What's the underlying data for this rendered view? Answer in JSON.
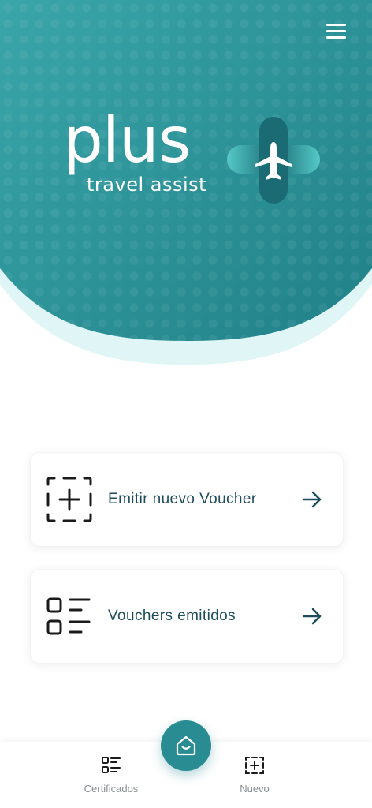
{
  "header": {
    "logo_word": "plus",
    "logo_tagline": "travel assist",
    "colors": {
      "teal_dark": "#1f7f86",
      "teal_light": "#3aa6a9",
      "ring": "#dff5f6"
    },
    "menu_icon": "hamburger-menu-icon"
  },
  "actions": [
    {
      "label": "Emitir nuevo Voucher",
      "icon": "add-square-icon",
      "arrow_icon": "arrow-right-icon"
    },
    {
      "label": "Vouchers emitidos",
      "icon": "list-icon",
      "arrow_icon": "arrow-right-icon"
    }
  ],
  "bottom_nav": {
    "items": [
      {
        "label": "Certificados",
        "icon": "certificates-list-icon"
      },
      {
        "label": "Nuevo",
        "icon": "new-voucher-icon"
      }
    ],
    "home_icon": "home-icon"
  }
}
